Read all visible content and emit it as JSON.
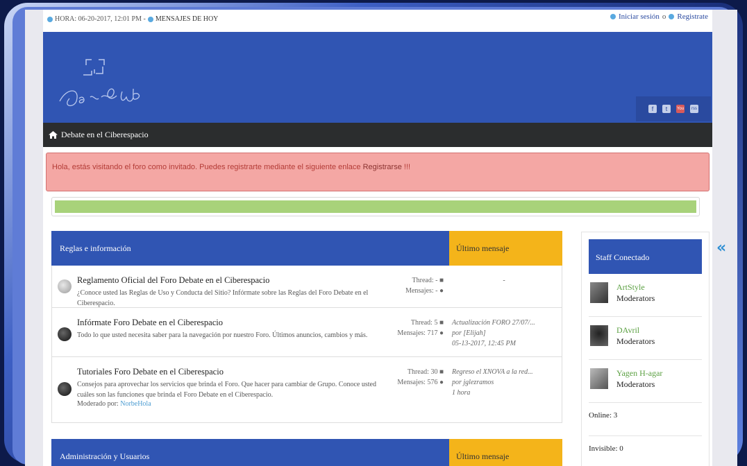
{
  "topbar": {
    "clock_text": "HORA: 06-20-2017, 12:01 PM - ",
    "messages_today": "MENSAJES DE HOY",
    "login": "Iniciar sesión",
    "or": "o",
    "register": "Registrate"
  },
  "social": [
    "f",
    "t",
    "You",
    "rss"
  ],
  "nav": {
    "breadcrumb": "Debate en el Ciberespacio"
  },
  "alert": {
    "text": "Hola, estás visitando el foro como invitado. Puedes registrarte mediante el siguiente enlace ",
    "link": "Registrarse",
    "suffix": " !!!"
  },
  "category1": {
    "title": "Reglas e información",
    "last_header": "Último mensaje",
    "forums": [
      {
        "title": "Reglamento Oficial del Foro Debate en el Ciberespacio",
        "desc": "¿Conoce usted las Reglas de Uso y Conducta del Sitio? Infórmate sobre las Reglas del Foro Debate en el Ciberespacio.",
        "threads": "Thread: -",
        "posts": "Mensajes: -",
        "last_line1": "-",
        "last_line2": "",
        "last_line3": ""
      },
      {
        "title": "Infórmate Foro Debate en el Ciberespacio",
        "desc": "Todo lo que usted necesita saber para la navegación por nuestro Foro. Últimos anuncios, cambios y más.",
        "threads": "Thread: 5",
        "posts": "Mensajes: 717",
        "last_line1": "Actualización FORO 27/07/...",
        "last_line2": "por [Elijah]",
        "last_line3": "05-13-2017, 12:45 PM"
      },
      {
        "title": "Tutoriales Foro Debate en el Ciberespacio",
        "desc": "Consejos para aprovechar los servicios que brinda el Foro. Que hacer para cambiar de Grupo. Conoce usted cuáles son las funciones que brinda el Foro Debate en el Ciberespacio.",
        "mod_label": "Moderado por: ",
        "mod_name": "NorbeHola",
        "threads": "Thread: 30",
        "posts": "Mensajes: 576",
        "last_line1": "Regreso el XNOVA a la red...",
        "last_line2": "por jglezramos",
        "last_line3": "1 hora"
      }
    ]
  },
  "category2": {
    "title": "Administración y Usuarios",
    "last_header": "Último mensaje"
  },
  "sidebar": {
    "title": "Staff Conectado",
    "members": [
      {
        "name": "ArtStyle",
        "role": "Moderators"
      },
      {
        "name": "DAvril",
        "role": "Moderators"
      },
      {
        "name": "Yagen H-agar",
        "role": "Moderators"
      }
    ],
    "online": "Online: 3",
    "invisible": "Invisible: 0"
  },
  "colors": {
    "header_blue": "#3055b3",
    "accent_orange": "#f4b41a",
    "alert_pink": "#f4a7a4",
    "progress_green": "#a8d27a",
    "nav_dark": "#2b2d2e",
    "member_green": "#5ba042"
  },
  "icons": [
    "clock-icon",
    "messages-icon",
    "login-icon",
    "register-icon",
    "home-icon",
    "thread-icon",
    "post-icon",
    "collapse-icon"
  ]
}
